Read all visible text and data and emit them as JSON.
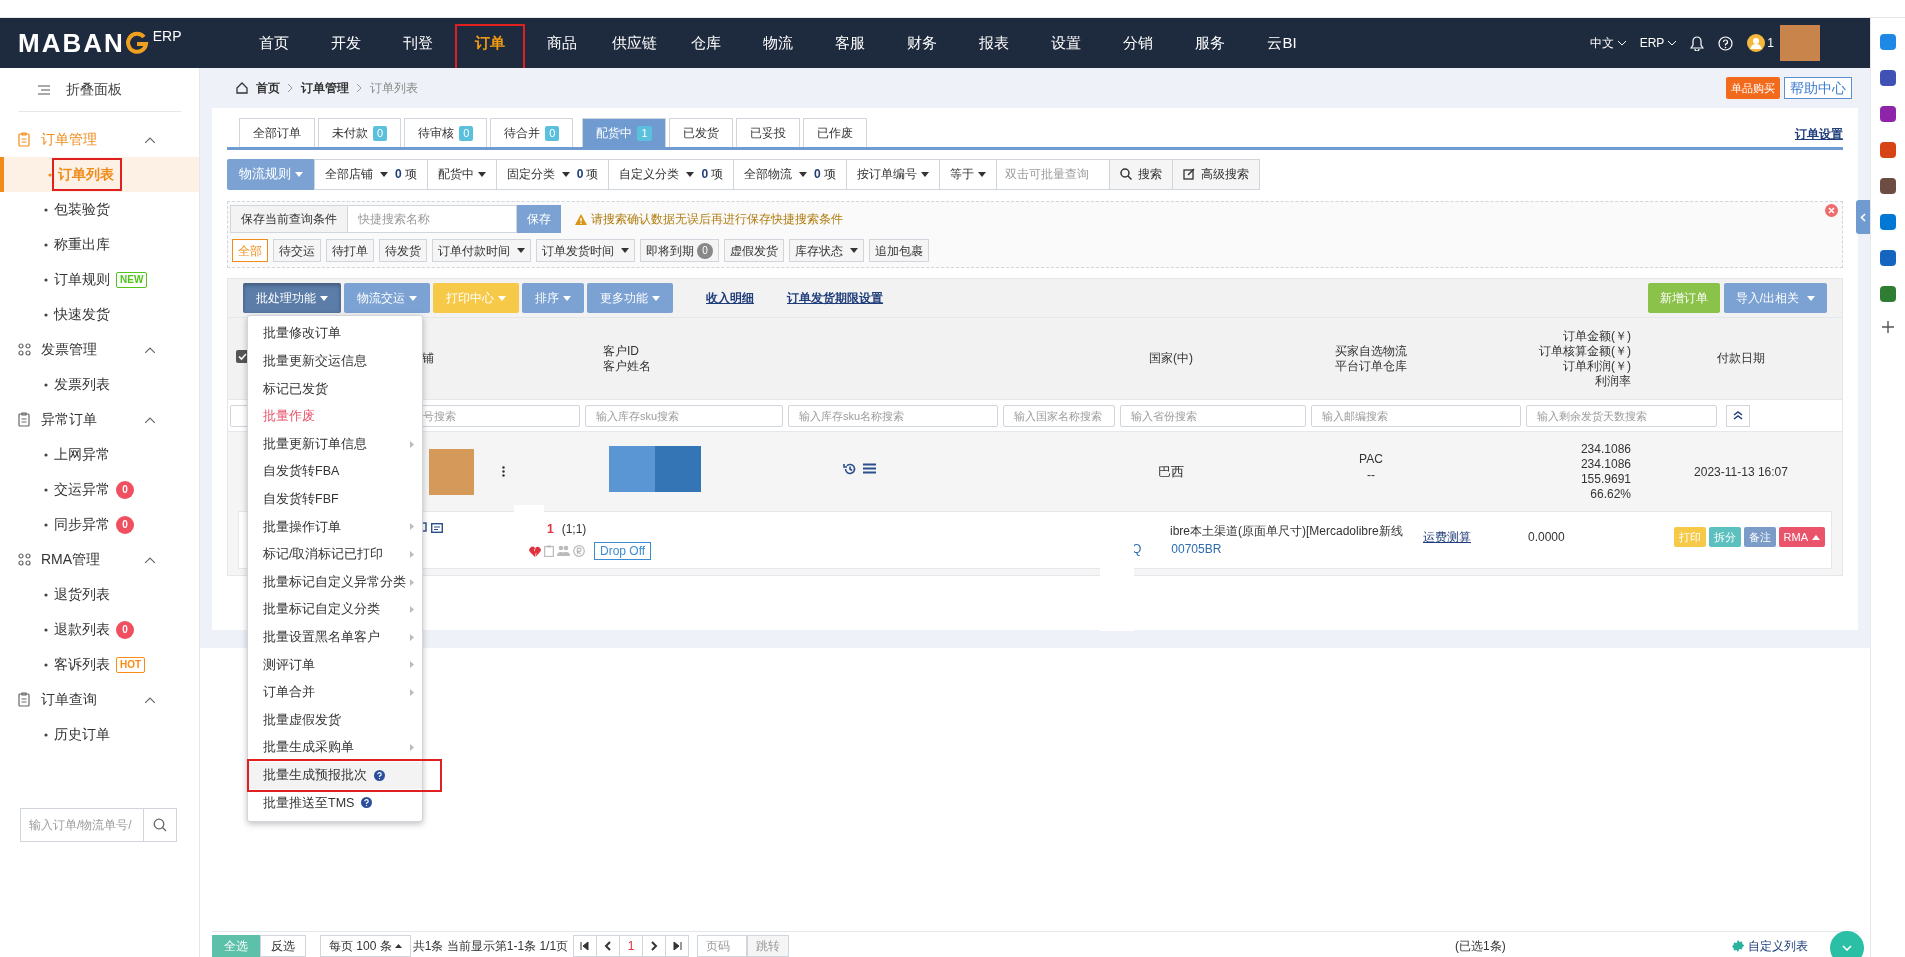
{
  "header": {
    "logo": "MABAN",
    "logo_suffix": "ERP",
    "nav": [
      {
        "label": "首页",
        "selected": false
      },
      {
        "label": "开发",
        "selected": false
      },
      {
        "label": "刊登",
        "selected": false
      },
      {
        "label": "订单",
        "selected": true
      },
      {
        "label": "商品",
        "selected": false
      },
      {
        "label": "供应链",
        "selected": false
      },
      {
        "label": "仓库",
        "selected": false
      },
      {
        "label": "物流",
        "selected": false
      },
      {
        "label": "客服",
        "selected": false
      },
      {
        "label": "财务",
        "selected": false
      },
      {
        "label": "报表",
        "selected": false
      },
      {
        "label": "设置",
        "selected": false
      },
      {
        "label": "分销",
        "selected": false
      },
      {
        "label": "服务",
        "selected": false
      },
      {
        "label": "云BI",
        "selected": false
      }
    ],
    "language": "中文",
    "erp_menu": "ERP",
    "user_initial": "1"
  },
  "sidebar": {
    "collapse": "折叠面板",
    "groups": [
      {
        "title": "订单管理",
        "kind": "clipboard",
        "expanded": true,
        "active": true,
        "items": [
          {
            "label": "订单列表",
            "selected": true
          },
          {
            "label": "包装验货",
            "selected": false
          },
          {
            "label": "称重出库",
            "selected": false
          },
          {
            "label": "订单规则",
            "selected": false,
            "tag": "NEW",
            "color": "#52c41a"
          },
          {
            "label": "快速发货",
            "selected": false
          }
        ]
      },
      {
        "title": "发票管理",
        "kind": "grid",
        "expanded": true,
        "active": false,
        "items": [
          {
            "label": "发票列表",
            "selected": false
          }
        ]
      },
      {
        "title": "异常订单",
        "kind": "clipboard",
        "expanded": true,
        "active": false,
        "items": [
          {
            "label": "上网异常",
            "selected": false
          },
          {
            "label": "交运异常",
            "selected": false,
            "count": "0"
          },
          {
            "label": "同步异常",
            "selected": false,
            "count": "0"
          }
        ]
      },
      {
        "title": "RMA管理",
        "kind": "grid",
        "expanded": true,
        "active": false,
        "items": [
          {
            "label": "退货列表",
            "selected": false
          },
          {
            "label": "退款列表",
            "selected": false,
            "count": "0"
          },
          {
            "label": "客诉列表",
            "selected": false,
            "tag": "HOT",
            "color": "#fa8c16"
          }
        ]
      },
      {
        "title": "订单查询",
        "kind": "clipboard",
        "expanded": true,
        "active": false,
        "items": [
          {
            "label": "历史订单",
            "selected": false
          }
        ]
      }
    ],
    "search_placeholder": "输入订单/物流单号/"
  },
  "breadcrumb": [
    "首页",
    "订单管理",
    "订单列表"
  ],
  "promo_badge": "单品购买",
  "help_link": "帮助中心",
  "status_tabs": [
    {
      "label": "全部订单",
      "selected": false
    },
    {
      "label": "未付款",
      "count": "0",
      "selected": false
    },
    {
      "label": "待审核",
      "count": "0",
      "selected": false
    },
    {
      "label": "待合并",
      "count": "0",
      "selected": false
    },
    {
      "label": "配货中",
      "count": "1",
      "selected": true
    },
    {
      "label": "已发货",
      "selected": false
    },
    {
      "label": "已妥投",
      "selected": false
    },
    {
      "label": "已作废",
      "selected": false
    }
  ],
  "settings_link": "订单设置",
  "filters": [
    {
      "kind": "primary",
      "label": "物流规则"
    },
    {
      "kind": "count",
      "label": "全部店铺",
      "count": "0",
      "unit": "项"
    },
    {
      "kind": "dropdown",
      "label": "配货中"
    },
    {
      "kind": "count",
      "label": "固定分类",
      "count": "0",
      "unit": "项"
    },
    {
      "kind": "count",
      "label": "自定义分类",
      "count": "0",
      "unit": "项"
    },
    {
      "kind": "count",
      "label": "全部物流",
      "count": "0",
      "unit": "项"
    },
    {
      "kind": "dropdown",
      "label": "按订单编号"
    },
    {
      "kind": "dropdown",
      "label": "等于"
    },
    {
      "kind": "input",
      "placeholder": "双击可批量查询"
    },
    {
      "kind": "search",
      "label": "搜索"
    },
    {
      "kind": "advanced",
      "label": "高级搜索"
    }
  ],
  "quick_search": {
    "save_label": "保存当前查询条件",
    "placeholder": "快捷搜索名称",
    "save_button": "保存",
    "warning": "请搜索确认数据无误后再进行保存快捷搜索条件"
  },
  "quick_filters": [
    {
      "label": "全部",
      "selected": true
    },
    {
      "label": "待交运",
      "selected": false
    },
    {
      "label": "待打单",
      "selected": false
    },
    {
      "label": "待发货",
      "selected": false
    },
    {
      "label": "订单付款时间",
      "dropdown": true,
      "selected": false
    },
    {
      "label": "订单发货时间",
      "dropdown": true,
      "selected": false
    },
    {
      "label": "即将到期",
      "count": "0",
      "selected": false
    },
    {
      "label": "虚假发货",
      "selected": false
    },
    {
      "label": "库存状态",
      "dropdown": true,
      "selected": false
    },
    {
      "label": "追加包裹",
      "selected": false
    }
  ],
  "actions": [
    {
      "label": "批处理功能",
      "color": "#5b7da8",
      "expanded": true
    },
    {
      "label": "物流交运",
      "color": "#7ba2d3",
      "expanded": false
    },
    {
      "label": "打印中心",
      "color": "#f7c948",
      "expanded": false
    },
    {
      "label": "排序",
      "color": "#7ba2d3",
      "expanded": false
    },
    {
      "label": "更多功能",
      "color": "#7ba2d3",
      "expanded": false
    }
  ],
  "links": [
    "收入明细",
    "订单发货期限设置"
  ],
  "right_actions": [
    {
      "label": "新增订单",
      "color": "#8bc34a",
      "dropdown": false
    },
    {
      "label": "导入/出相关",
      "color": "#7ba2d3",
      "dropdown": true
    }
  ],
  "batch_menu": [
    {
      "label": "批量修改订单",
      "submenu": false,
      "danger": false,
      "help": false,
      "hovered": false
    },
    {
      "label": "批量更新交运信息",
      "submenu": false,
      "danger": false,
      "help": false,
      "hovered": false
    },
    {
      "label": "标记已发货",
      "submenu": false,
      "danger": false,
      "help": false,
      "hovered": false
    },
    {
      "label": "批量作废",
      "submenu": false,
      "danger": true,
      "help": false,
      "hovered": false
    },
    {
      "label": "批量更新订单信息",
      "submenu": true,
      "danger": false,
      "help": false,
      "hovered": false
    },
    {
      "label": "自发货转FBA",
      "submenu": false,
      "danger": false,
      "help": false,
      "hovered": false
    },
    {
      "label": "自发货转FBF",
      "submenu": false,
      "danger": false,
      "help": false,
      "hovered": false
    },
    {
      "label": "批量操作订单",
      "submenu": true,
      "danger": false,
      "help": false,
      "hovered": false
    },
    {
      "label": "标记/取消标记已打印",
      "submenu": true,
      "danger": false,
      "help": false,
      "hovered": false
    },
    {
      "label": "批量标记自定义异常分类",
      "submenu": true,
      "danger": false,
      "help": false,
      "hovered": false
    },
    {
      "label": "批量标记自定义分类",
      "submenu": true,
      "danger": false,
      "help": false,
      "hovered": false
    },
    {
      "label": "批量设置黑名单客户",
      "submenu": true,
      "danger": false,
      "help": false,
      "hovered": false
    },
    {
      "label": "测评订单",
      "submenu": true,
      "danger": false,
      "help": false,
      "hovered": false
    },
    {
      "label": "订单合并",
      "submenu": true,
      "danger": false,
      "help": false,
      "hovered": false
    },
    {
      "label": "批量虚假发货",
      "submenu": false,
      "danger": false,
      "help": false,
      "hovered": false
    },
    {
      "label": "批量生成采购单",
      "submenu": true,
      "danger": false,
      "help": false,
      "hovered": false
    },
    {
      "label": "批量生成预报批次",
      "submenu": false,
      "danger": false,
      "help": true,
      "hovered": true
    },
    {
      "label": "批量推送至TMS",
      "submenu": false,
      "danger": false,
      "help": true,
      "hovered": false
    }
  ],
  "table": {
    "select_all_checked": true,
    "columns": [
      [
        "铺"
      ],
      [
        "客户ID",
        "客户姓名"
      ],
      [],
      [
        "国家(中)"
      ],
      [
        "买家自选物流",
        "平台订单仓库"
      ],
      [
        "订单金额(￥)",
        "订单核算金额(￥)",
        "订单利润(￥)",
        "利润率"
      ],
      [
        "付款日期"
      ]
    ],
    "search_placeholders": [
      "号搜索",
      "输入库存sku搜索",
      "输入库存sku名称搜索",
      "输入国家名称搜索",
      "输入省份搜索",
      "输入邮编搜索",
      "输入剩余发货天数搜索"
    ],
    "rows": [
      {
        "country": "巴西",
        "logistics": [
          "PAC",
          "--"
        ],
        "amounts": [
          "234.1086",
          "234.1086",
          "155.9691",
          "66.62%"
        ],
        "paid_at": "2023-11-13 16:07",
        "detail": {
          "quantity": "1",
          "quantity_note": "(1;1)",
          "tag": "Drop Off",
          "prefix": "Q",
          "channel": "ibre本土渠道(原面单尺寸)[Mercadolibre新线",
          "tracking": "00705BR",
          "freight_link": "运费测算",
          "freight": "0.0000",
          "buttons": [
            {
              "label": "打印",
              "color": "#f7c948",
              "dropdown": false
            },
            {
              "label": "拆分",
              "color": "#5bc0be",
              "dropdown": false
            },
            {
              "label": "备注",
              "color": "#7a9cc6",
              "dropdown": false
            },
            {
              "label": "RMA",
              "color": "#e9546b",
              "dropdown": true
            }
          ]
        }
      }
    ]
  },
  "pager": {
    "select_all": "全选",
    "invert": "反选",
    "page_size": "每页 100 条",
    "summary": "共1条 当前显示第1-1条 1/1页",
    "current_page": "1",
    "page_placeholder": "页码",
    "jump": "跳转",
    "selected_count": "(已选1条)",
    "custom_list": "自定义列表"
  }
}
